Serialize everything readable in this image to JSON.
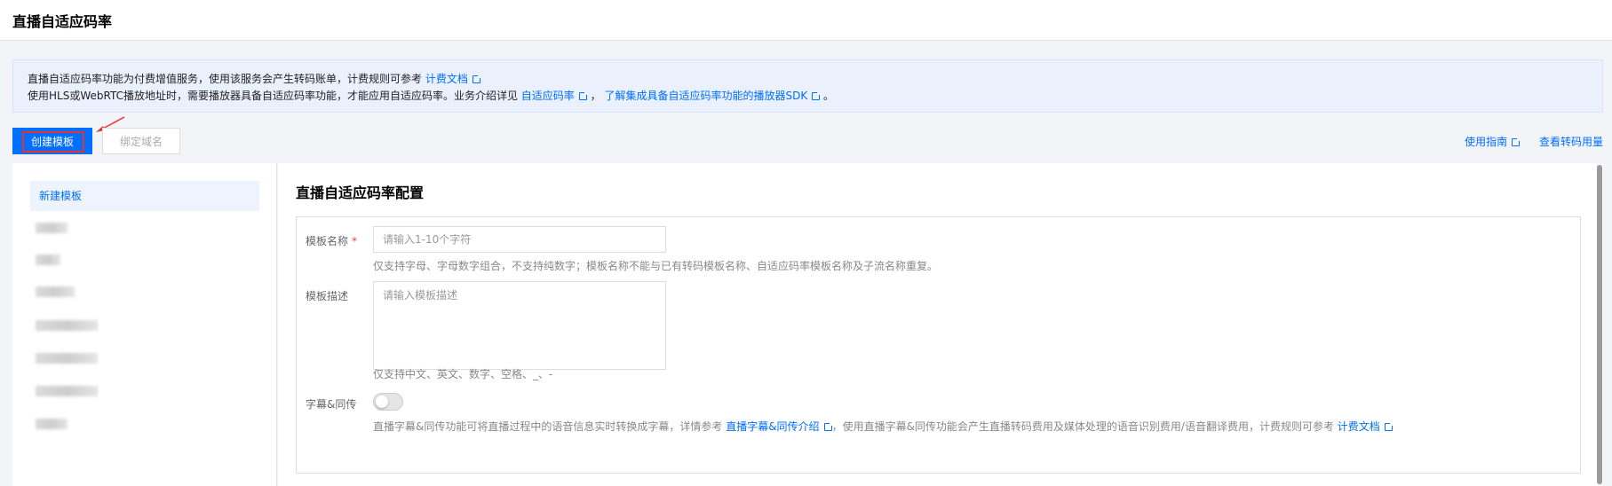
{
  "page_title": "直播自适应码率",
  "banner": {
    "line1_text": "直播自适应码率功能为付费增值服务，使用该服务会产生转码账单，计费规则可参考",
    "line1_link": "计费文档",
    "line2_text": "使用HLS或WebRTC播放地址时，需要播放器具备自适应码率功能，才能应用自适应码率。业务介绍详见",
    "line2_link1": "自适应码率",
    "line2_sep": "，",
    "line2_link2": "了解集成具备自适应码率功能的播放器SDK",
    "line2_end": "。"
  },
  "toolbar": {
    "create_label": "创建模板",
    "bind_label": "绑定域名",
    "guide_link": "使用指南",
    "usage_link": "查看转码用量"
  },
  "sidebar": {
    "active_item": "新建模板"
  },
  "form": {
    "heading": "直播自适应码率配置",
    "name_label": "模板名称",
    "name_required": "*",
    "name_placeholder": "请输入1-10个字符",
    "name_hint": "仅支持字母、字母数字组合，不支持纯数字；模板名称不能与已有转码模板名称、自适应码率模板名称及子流名称重复。",
    "desc_label": "模板描述",
    "desc_placeholder": "请输入模板描述",
    "desc_hint": "仅支持中文、英文、数字、空格、_、-",
    "subtitle_label": "字幕&同传",
    "subtitle_enabled": false,
    "subtitle_hint_1": "直播字幕&同传功能可将直播过程中的语音信息实时转换成字幕，详情参考",
    "subtitle_link1": "直播字幕&同传介绍",
    "subtitle_hint_2": "，使用直播字幕&同传功能会产生直播转码费用及媒体处理的语音识别费用/语音翻译费用，计费规则可参考",
    "subtitle_link2": "计费文档"
  },
  "colors": {
    "primary": "#006eff",
    "highlight": "#e8322b",
    "banner_bg": "#eaf1fd"
  }
}
